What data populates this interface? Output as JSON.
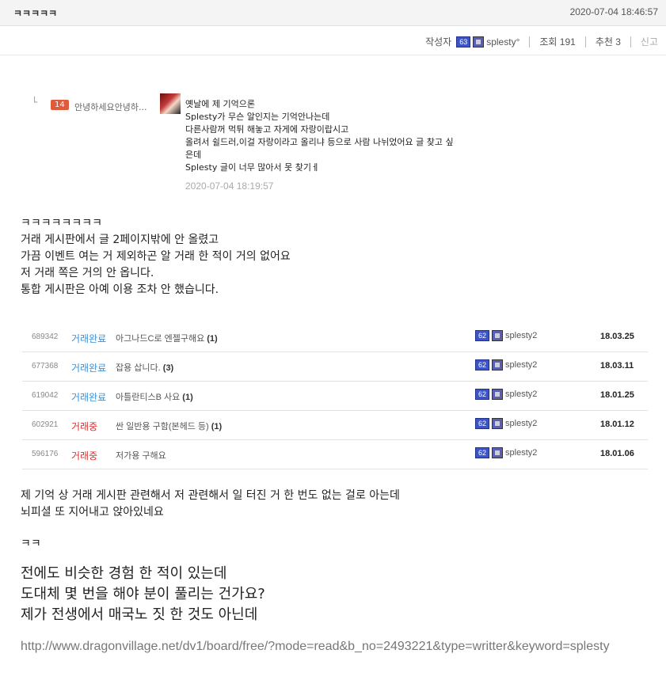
{
  "header": {
    "title": "ㅋㅋㅋㅋㅋ",
    "date": "2020-07-04 18:46:57"
  },
  "meta": {
    "author_label": "작성자",
    "author_level": "63",
    "author_name": "splesty°",
    "views": "조회 191",
    "recommend": "추천 3",
    "report": "신고"
  },
  "reply": {
    "corner": "└",
    "badge": "14",
    "name": "안녕하세요안녕하...",
    "lines": [
      "옛날에 제 기억으론",
      "Splesty가 무슨 알인지는 기억안나는데",
      "다른사람꺼 먹튀 해놓고 자게에 자랑이랍시고",
      "올려서 쉴드러,이걸 자랑이라고 올리냐 등으로 사람 나뉘었어요 글 찾고 싶",
      "은데",
      "Splesty 글이 너무 많아서 못 찾기ㅔ"
    ],
    "date": "2020-07-04 18:19:57"
  },
  "body1": [
    "ㅋㅋㅋㅋㅋㅋㅋㅋ",
    "거래 게시판에서 글 2페이지밖에 안 올렸고",
    "가끔 이벤트 여는 거 제외하곤 알 거래 한 적이 거의 없어요",
    "저 거래 쪽은 거의 안 옵니다.",
    "통합 게시판은 아예 이용 조차 안 했습니다."
  ],
  "trades": [
    {
      "no": "689342",
      "status": "거래완료",
      "status_type": "done",
      "subject": "아그나드C로 엔젤구해요",
      "count": "(1)",
      "level": "62",
      "user": "splesty2",
      "date": "18.03.25"
    },
    {
      "no": "677368",
      "status": "거래완료",
      "status_type": "done",
      "subject": "잡용 삽니다.",
      "count": "(3)",
      "level": "62",
      "user": "splesty2",
      "date": "18.03.11"
    },
    {
      "no": "619042",
      "status": "거래완료",
      "status_type": "done",
      "subject": "아틀란티스B 사요",
      "count": "(1)",
      "level": "62",
      "user": "splesty2",
      "date": "18.01.25"
    },
    {
      "no": "602921",
      "status": "거래중",
      "status_type": "ing",
      "subject": "싼 일반용 구함(본헤드 등)",
      "count": "(1)",
      "level": "62",
      "user": "splesty2",
      "date": "18.01.12"
    },
    {
      "no": "596176",
      "status": "거래중",
      "status_type": "ing",
      "subject": "저가용 구해요",
      "count": "",
      "level": "62",
      "user": "splesty2",
      "date": "18.01.06"
    }
  ],
  "body2": [
    "제 기억 상 거래 게시판 관련해서 저 관련해서 일 터진 거 한 번도 없는 걸로 아는데",
    "뇌피셜 또 지어내고 앉아있네요"
  ],
  "body3": "ㅋㅋ",
  "body4": [
    "전에도 비슷한 경험 한 적이 있는데",
    "도대체 몇 번을 해야 분이 풀리는 건가요?",
    "제가 전생에서 매국노 짓 한 것도 아닌데"
  ],
  "link": "http://www.dragonvillage.net/dv1/board/free/?mode=read&b_no=2493221&type=writter&keyword=splesty",
  "colors": {
    "done": "#3a8fd6",
    "ing": "#d83030",
    "level_badge": "#3b55c8",
    "reply_badge": "#e05a3c"
  }
}
